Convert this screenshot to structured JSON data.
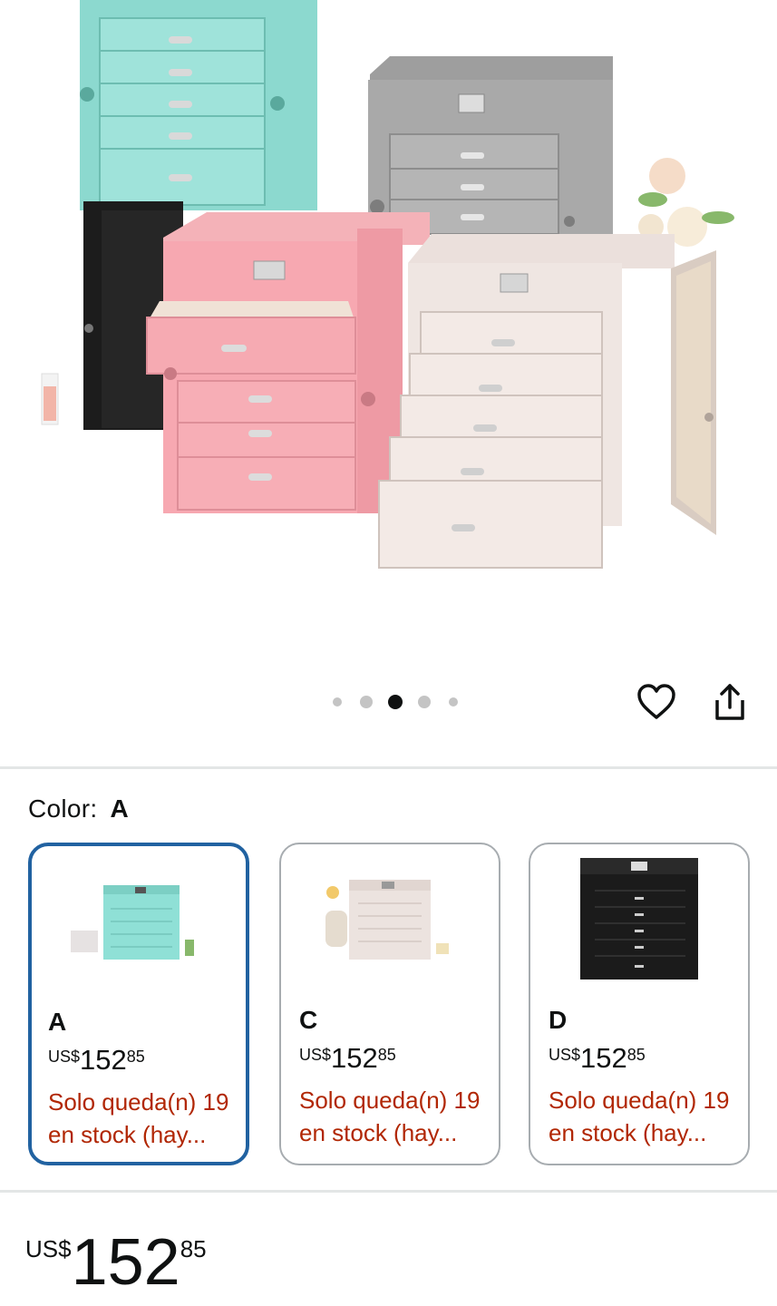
{
  "gallery": {
    "total_images": 5,
    "active_index": 2
  },
  "actions": {
    "favorite_icon": "heart-icon",
    "share_icon": "share-icon"
  },
  "color_selector": {
    "label": "Color:",
    "selected_value": "A",
    "options": [
      {
        "name": "A",
        "price_currency": "US$",
        "price_whole": "152",
        "price_fraction": "85",
        "stock_text": "Solo queda(n) 19 en stock (hay...",
        "selected": true,
        "body_color": "#8fe0d6"
      },
      {
        "name": "C",
        "price_currency": "US$",
        "price_whole": "152",
        "price_fraction": "85",
        "stock_text": "Solo queda(n) 19 en stock (hay...",
        "selected": false,
        "body_color": "#e8dfdc"
      },
      {
        "name": "D",
        "price_currency": "US$",
        "price_whole": "152",
        "price_fraction": "85",
        "stock_text": "Solo queda(n) 19 en stock (hay...",
        "selected": false,
        "body_color": "#1b1b1b"
      }
    ]
  },
  "price": {
    "currency": "US$",
    "whole": "152",
    "fraction": "85"
  },
  "colors": {
    "selected_border": "#2162a1",
    "stock_text": "#b12704",
    "divider": "#e3e6e6"
  }
}
